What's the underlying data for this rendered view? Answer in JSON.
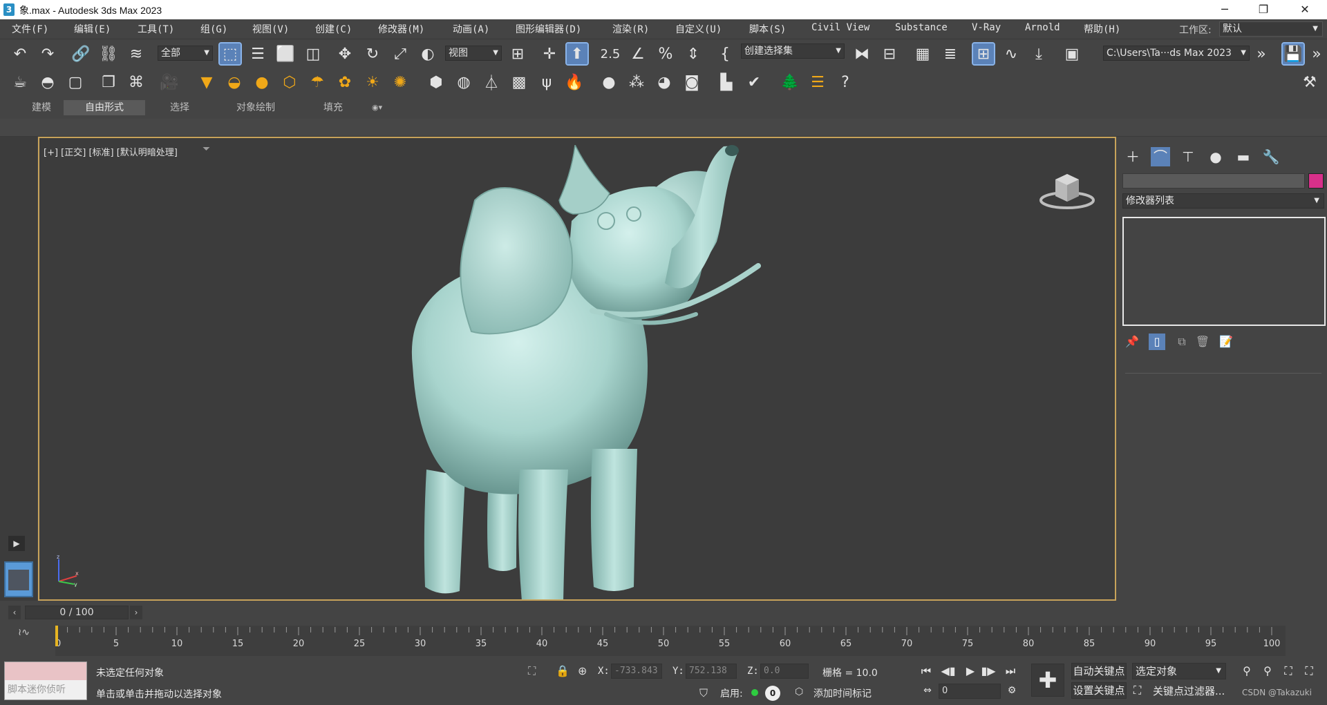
{
  "window": {
    "title": "象.max - Autodesk 3ds Max 2023",
    "minimize": "─",
    "restore": "❐",
    "close": "✕"
  },
  "menu": {
    "items": [
      "文件(F)",
      "编辑(E)",
      "工具(T)",
      "组(G)",
      "视图(V)",
      "创建(C)",
      "修改器(M)",
      "动画(A)",
      "图形编辑器(D)",
      "渲染(R)",
      "自定义(U)",
      "脚本(S)",
      "Civil View",
      "Substance",
      "V-Ray",
      "Arnold",
      "帮助(H)"
    ],
    "workspace_label": "工作区:",
    "workspace_value": "默认"
  },
  "toolbar": {
    "filter_dropdown": "全部",
    "refcoord_dropdown": "视图",
    "selection_set": "创建选择集",
    "path_dropdown": "C:\\Users\\Ta···ds Max 2023",
    "snap_label": "2.5",
    "icon_row1": [
      "undo-icon",
      "redo-icon",
      "link-icon",
      "unlink-icon",
      "bind-spacewarp-icon",
      "select-object-icon",
      "select-by-name-icon",
      "rect-selection-icon",
      "window-crossing-icon",
      "move-icon",
      "rotate-icon",
      "scale-icon",
      "placement-icon",
      "use-pivot-icon",
      "manipulate-icon",
      "snap-toggle-icon",
      "angle-snap-icon",
      "percent-snap-icon",
      "spinner-snap-icon",
      "edit-named-selection-icon",
      "mirror-icon",
      "align-icon",
      "scene-explorer-icon",
      "layer-explorer-icon",
      "ribbon-toggle-icon",
      "curve-editor-icon",
      "schematic-view-icon",
      "material-editor-icon"
    ],
    "icon_row2": [
      "teapot-icon",
      "vray-torus-icon",
      "vray-box-icon",
      "vray-proxy-icon",
      "vray-fur-icon",
      "vray-camera-icon",
      "vray-plane-light-icon",
      "vray-dome-light-icon",
      "vray-sphere-light-icon",
      "vray-mesh-light-icon",
      "vray-ies-light-icon",
      "vray-ambient-light-icon",
      "vray-sun-icon",
      "vray-sky-icon",
      "vray-clipper-icon",
      "vray-decal-icon",
      "vray-scatter-icon",
      "vray-enmesh-icon",
      "vray-fire-icon",
      "vray-material-icon",
      "vray-multi-material-icon",
      "vray-lightmix-icon",
      "vray-vfb-icon",
      "vray-frame-buffer-icon",
      "vray-logo-icon",
      "chaos-cosmos-icon",
      "vray-list-icon",
      "help-icon"
    ]
  },
  "ribbon": {
    "tabs": [
      "建模",
      "自由形式",
      "选择",
      "对象绘制",
      "填充"
    ],
    "active_tab": "自由形式"
  },
  "viewport": {
    "label": "[+] [正交] [标准] [默认明暗处理]",
    "background": "#3c3c3c",
    "border_color": "#c8a35a",
    "model_color": "#b6dcd6",
    "axis_labels": [
      "z",
      "x",
      "y"
    ]
  },
  "command_panel": {
    "tabs": [
      "create-icon",
      "modify-icon",
      "hierarchy-icon",
      "motion-icon",
      "display-icon",
      "utilities-icon"
    ],
    "active_tab": "modify-icon",
    "object_color": "#d8308a",
    "modifier_list": "修改器列表",
    "stack_buttons": [
      "pin-stack-icon",
      "show-end-result-icon",
      "make-unique-icon",
      "remove-modifier-icon",
      "configure-modifier-sets-icon"
    ]
  },
  "time_slider": {
    "frame_label": "0 / 100",
    "ticks": [
      0,
      5,
      10,
      15,
      20,
      25,
      30,
      35,
      40,
      45,
      50,
      55,
      60,
      65,
      70,
      75,
      80,
      85,
      90,
      95,
      100
    ]
  },
  "status": {
    "maxscript_placeholder": "脚本迷你侦听",
    "msg1": "未选定任何对象",
    "msg2": "单击或单击并拖动以选择对象",
    "x_label": "X:",
    "x_value": "-733.843",
    "y_label": "Y:",
    "y_value": "752.138",
    "z_label": "Z:",
    "z_value": "0.0",
    "grid": "栅格 = 10.0",
    "enable": "启用:",
    "enable_count": "0",
    "add_time_tag": "添加时间标记",
    "auto_key": "自动关键点",
    "set_key": "设置关键点",
    "selected_object": "选定对象",
    "key_filters": "关键点过滤器...",
    "current_frame": "0",
    "watermark": "CSDN @Takazuki"
  }
}
